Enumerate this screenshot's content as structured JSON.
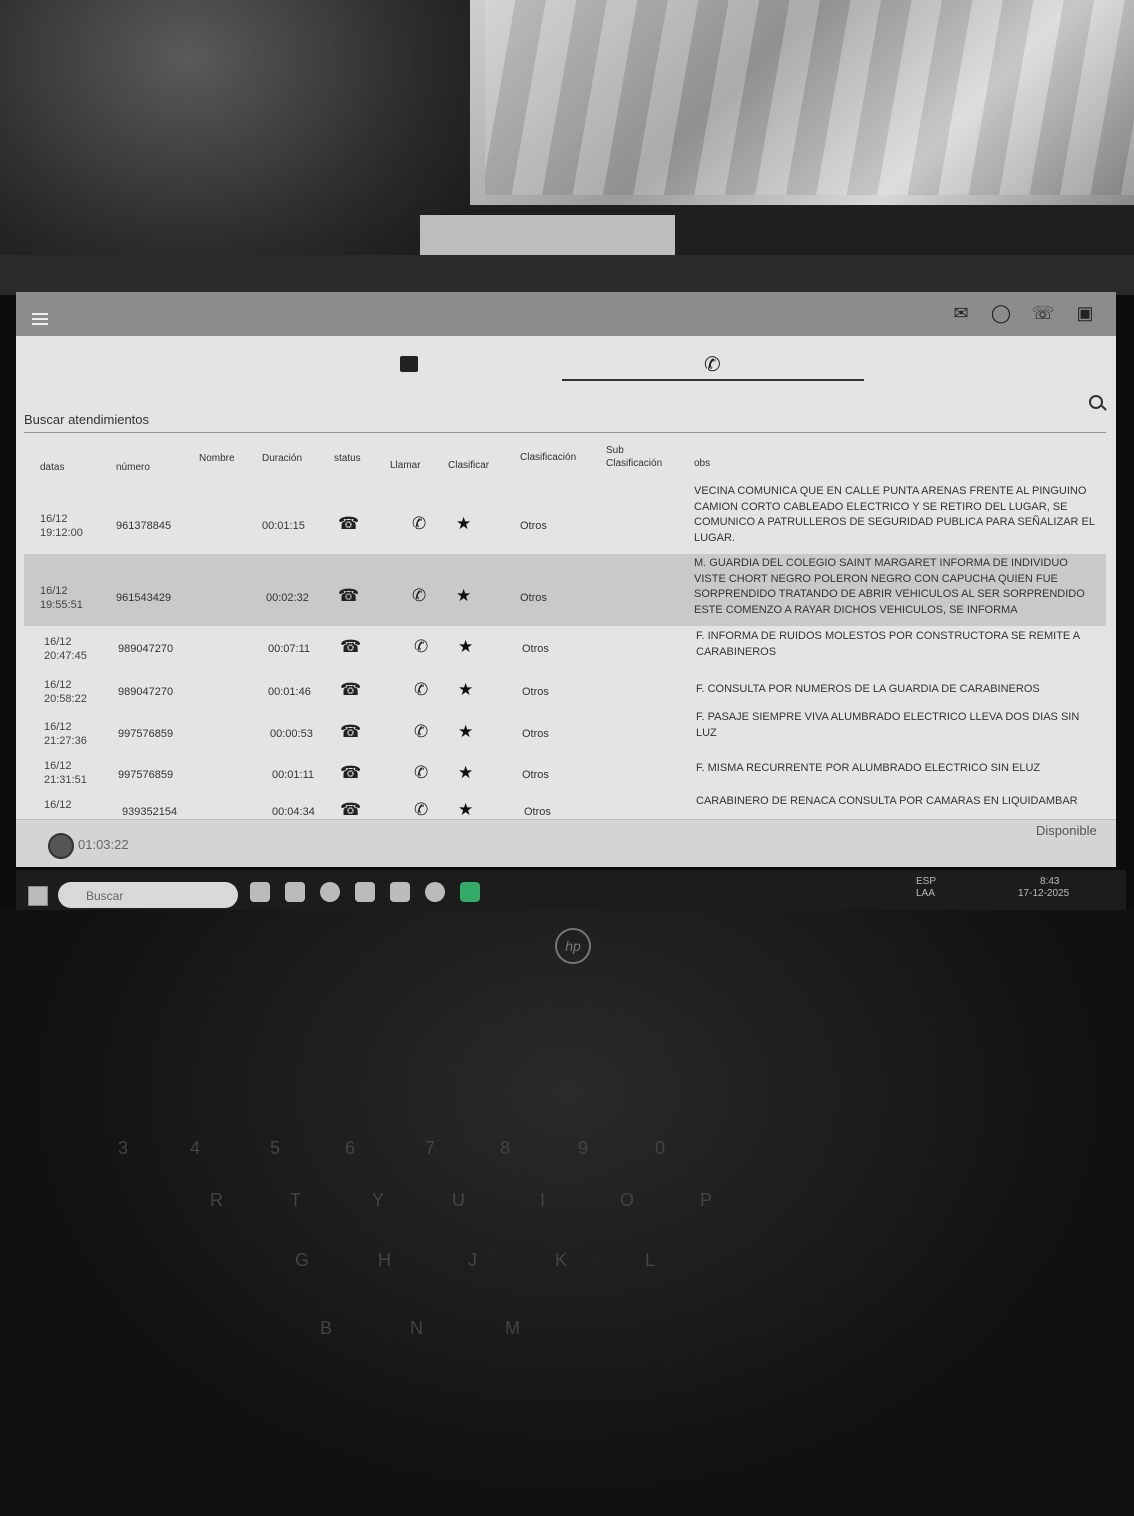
{
  "toolbar": {
    "menu": "menu-icon",
    "icons": [
      "mail-icon",
      "whatsapp-icon",
      "phone-list-icon",
      "calendar-icon"
    ]
  },
  "search": {
    "label": "Buscar atendimientos"
  },
  "columns": {
    "datas": "datas",
    "numero": "número",
    "nombre": "Nombre",
    "duracion": "Duración",
    "status": "status",
    "llamar": "Llamar",
    "clasificar": "Clasificar",
    "clasificacion": "Clasificación",
    "sub": "Sub Clasificación",
    "obs": "obs"
  },
  "rows": [
    {
      "date": "16/12",
      "time": "19:12:00",
      "numero": "961378845",
      "duracion": "00:01:15",
      "clasificacion": "Otros",
      "obs": "VECINA COMUNICA QUE EN CALLE PUNTA ARENAS FRENTE AL PINGUINO CAMION CORTO CABLEADO ELECTRICO Y SE RETIRO DEL LUGAR, SE COMUNICO A PATRULLEROS DE SEGURIDAD PUBLICA PARA SEÑALIZAR EL LUGAR."
    },
    {
      "date": "16/12",
      "time": "19:55:51",
      "numero": "961543429",
      "duracion": "00:02:32",
      "clasificacion": "Otros",
      "obs": "M. GUARDIA DEL COLEGIO SAINT MARGARET INFORMA DE INDIVIDUO VISTE CHORT NEGRO POLERON NEGRO CON CAPUCHA QUIEN FUE SORPRENDIDO TRATANDO DE ABRIR VEHICULOS AL SER SORPRENDIDO ESTE COMENZO A RAYAR DICHOS VEHICULOS, SE INFORMA"
    },
    {
      "date": "16/12",
      "time": "20:47:45",
      "numero": "989047270",
      "duracion": "00:07:11",
      "clasificacion": "Otros",
      "obs": "F. INFORMA DE RUIDOS MOLESTOS POR CONSTRUCTORA SE REMITE A CARABINEROS"
    },
    {
      "date": "16/12",
      "time": "20:58:22",
      "numero": "989047270",
      "duracion": "00:01:46",
      "clasificacion": "Otros",
      "obs": "F. CONSULTA POR NUMEROS DE LA GUARDIA DE CARABINEROS"
    },
    {
      "date": "16/12",
      "time": "21:27:36",
      "numero": "997576859",
      "duracion": "00:00:53",
      "clasificacion": "Otros",
      "obs": "F. PASAJE SIEMPRE VIVA ALUMBRADO ELECTRICO LLEVA DOS DIAS SIN LUZ"
    },
    {
      "date": "16/12",
      "time": "21:31:51",
      "numero": "997576859",
      "duracion": "00:01:11",
      "clasificacion": "Otros",
      "obs": "F. MISMA RECURRENTE POR ALUMBRADO ELECTRICO SIN ELUZ"
    },
    {
      "date": "16/12",
      "time": "",
      "numero": "939352154",
      "duracion": "00:04:34",
      "clasificacion": "Otros",
      "obs": "CARABINERO DE REÑACA CONSULTA POR CAMARAS EN LIQUIDAMBAR"
    }
  ],
  "footer": {
    "timer": "01:03:22",
    "status": "Disponible"
  },
  "taskbar": {
    "search": "Buscar",
    "lang1": "ESP",
    "lang2": "LAA",
    "time": "8:43",
    "date": "17-12-2025"
  },
  "laptop": {
    "keys": [
      "3",
      "4",
      "5",
      "6",
      "7",
      "8",
      "9",
      "0",
      "R",
      "T",
      "Y",
      "U",
      "I",
      "O",
      "P",
      "G",
      "H",
      "J",
      "K",
      "L",
      "B",
      "N",
      "M"
    ]
  }
}
